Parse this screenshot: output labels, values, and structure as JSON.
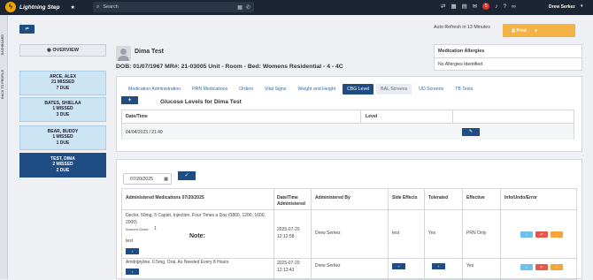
{
  "app": {
    "name": "Lightning Step"
  },
  "search": {
    "placeholder": "Search"
  },
  "header": {
    "notification_count": "5",
    "user_name": "Drew Serkez"
  },
  "rail": {
    "label_1": "DASHBOARD",
    "label_2": "BACK TO PROFILE"
  },
  "left": {
    "overview_label": "OVERVIEW",
    "patients": [
      {
        "name": "ARCE, ALEX",
        "line1": "21 MISSED",
        "line2": "7 DUE"
      },
      {
        "name": "BATES, SHIELAA",
        "line1": "1 MISSED",
        "line2": "3 DUE"
      },
      {
        "name": "BEAR, BUDDY",
        "line1": "1 MISSED",
        "line2": "1 DUE"
      },
      {
        "name": "TEST, DIMA",
        "line1": "2 MISSED",
        "line2": "2 DUE"
      }
    ]
  },
  "top_right": {
    "auto_refresh": "Auto Refresh in 13 Minutes",
    "print_label": "Print"
  },
  "patient": {
    "name": "Dima Test",
    "info": "DOB: 01/07/1967   MR#: 21-03005   Unit - Room - Bed: Womens Residential - 4 - 4C"
  },
  "allergies": {
    "title": "Medication Allergies",
    "value": "No Allergies Identified"
  },
  "tabs": [
    "Medication Administration",
    "PRN Medications",
    "Orders",
    "Vital Signs",
    "Weight and Height",
    "CBG Level",
    "BAL Screens",
    "UD Screens",
    "TB Tests"
  ],
  "cbg": {
    "add_label": "+",
    "title": "Glucose Levels for Dima Test",
    "columns": [
      "Date/Time",
      "Level"
    ],
    "rows": [
      {
        "datetime": "04/04/2023 / 21:40",
        "level": ""
      }
    ],
    "edit_icon": "pencil-icon"
  },
  "meds": {
    "date_value": "07/20/2025",
    "columns": {
      "admin": "Administered Medications 07/20/2025",
      "datetime": "Date/Time Administered",
      "by": "Administered By",
      "side": "Side Effects",
      "tolerated": "Tolerated",
      "effective": "Effective",
      "info": "Info/Undo/Error"
    },
    "rows": [
      {
        "med": "Declor, 50mg, 5 Caplet, Injection, Four Times a Day (0800, 1200, 1600, 2000)",
        "amount": "Amount Given:",
        "amount_val": "1",
        "extra": "test",
        "note": "Note:",
        "datetime": "2025-07-20 12:12:58",
        "by": "Drew Serkez",
        "side": "test",
        "tolerated": "Yes",
        "effective": "PRN Only"
      },
      {
        "med": "Amitriptyline, 0.5mg, Oral, As Needed Every 8 Hours",
        "datetime": "2025-07-20 12:13:43",
        "by": "Drew Serkez",
        "side": "",
        "tolerated": "",
        "effective": "Yes"
      }
    ]
  }
}
